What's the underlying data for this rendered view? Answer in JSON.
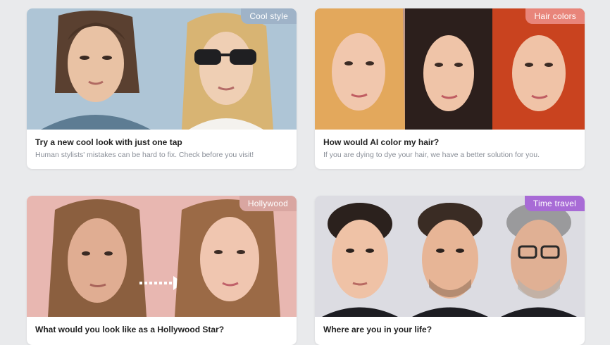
{
  "cards": [
    {
      "badge": "Cool style",
      "badge_color": "#9fb3c8",
      "title": "Try a new cool look with just one tap",
      "subtitle": "Human stylists' mistakes can be hard to fix. Check before you visit!",
      "photo_bg": "#aec5d6"
    },
    {
      "badge": "Hair colors",
      "badge_color": "#e8857a",
      "title": "How would AI color my hair?",
      "subtitle": "If you are dying to dye your hair, we have a better solution for you.",
      "photo_bg": "#c9a08c"
    },
    {
      "badge": "Hollywood",
      "badge_color": "#d9a6a1",
      "title": "What would you look like as a Hollywood Star?",
      "subtitle": "",
      "photo_bg": "#e7b3ad"
    },
    {
      "badge": "Time travel",
      "badge_color": "#a86bd6",
      "title": "Where are you in your life?",
      "subtitle": "",
      "photo_bg": "#d8d8de"
    }
  ]
}
